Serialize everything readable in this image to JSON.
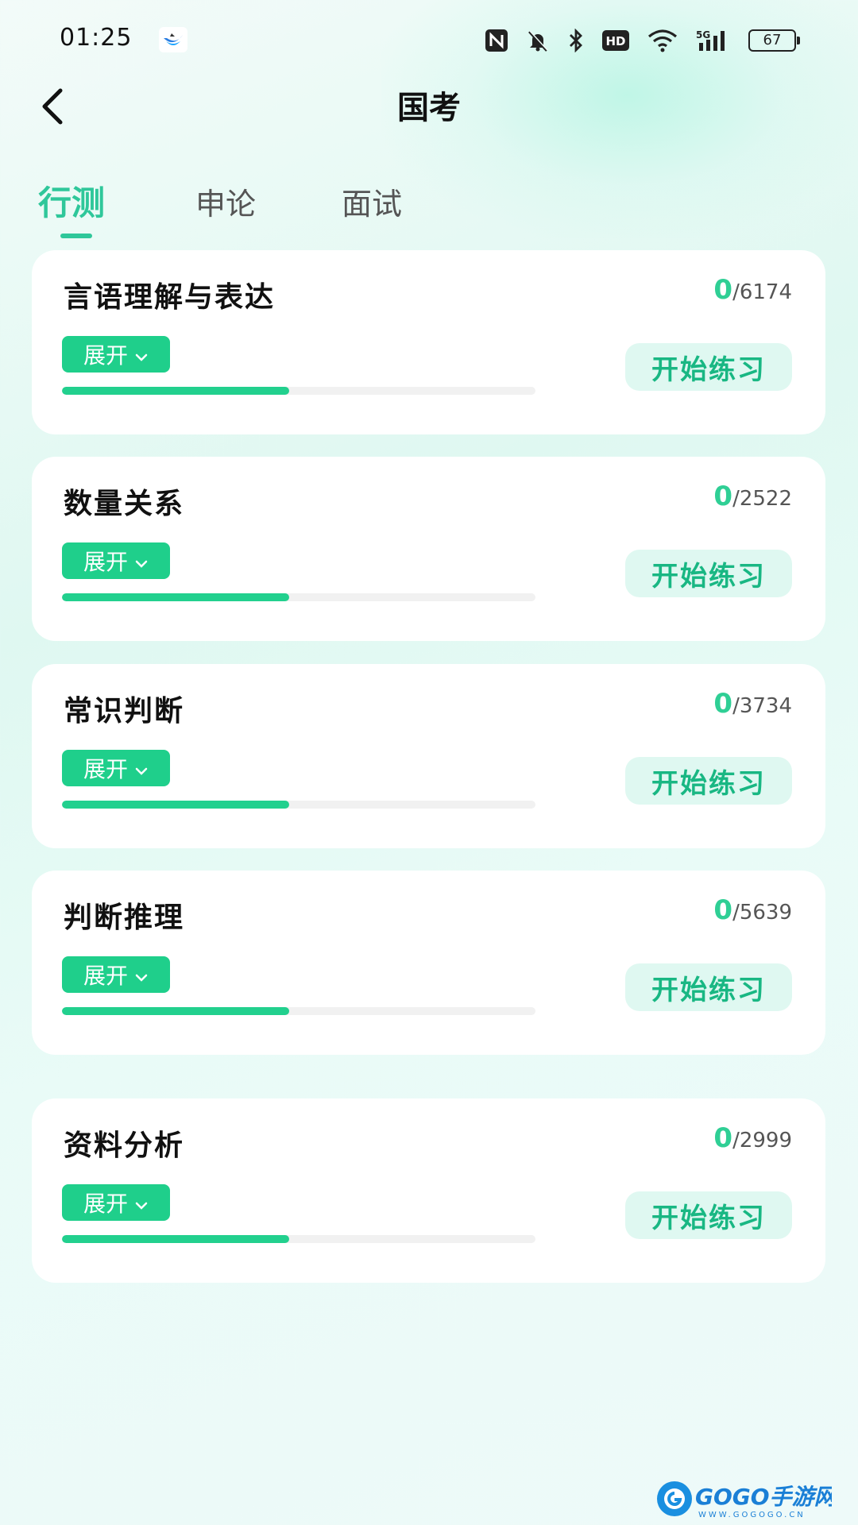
{
  "status_bar": {
    "time": "01:25",
    "app_icon": "blue-bird-app-icon",
    "icons": [
      "nfc-icon",
      "bell-off-icon",
      "bluetooth-icon",
      "hd-icon",
      "wifi-icon",
      "5g-signal-icon"
    ],
    "battery": "67"
  },
  "header": {
    "back_icon": "chevron-left-icon",
    "title": "国考"
  },
  "tabs": [
    {
      "label": "行测",
      "active": true
    },
    {
      "label": "申论",
      "active": false
    },
    {
      "label": "面试",
      "active": false
    }
  ],
  "sections": [
    {
      "title": "言语理解与表达",
      "done": "0",
      "total": "/6174",
      "expand_label": "展开",
      "start_label": "开始练习",
      "progress": 0.48
    },
    {
      "title": "数量关系",
      "done": "0",
      "total": "/2522",
      "expand_label": "展开",
      "start_label": "开始练习",
      "progress": 0.48
    },
    {
      "title": "常识判断",
      "done": "0",
      "total": "/3734",
      "expand_label": "展开",
      "start_label": "开始练习",
      "progress": 0.48
    },
    {
      "title": "判断推理",
      "done": "0",
      "total": "/5639",
      "expand_label": "展开",
      "start_label": "开始练习",
      "progress": 0.48
    },
    {
      "title": "资料分析",
      "done": "0",
      "total": "/2999",
      "expand_label": "展开",
      "start_label": "开始练习",
      "progress": 0.48
    }
  ],
  "watermark": {
    "text": "GOGO手游网",
    "sub": "WWW.GOGOGO.CN"
  },
  "colors": {
    "accent": "#2fc79a",
    "button_green": "#1fcf8b",
    "start_bg": "#dff8f1",
    "start_text": "#19b783"
  }
}
